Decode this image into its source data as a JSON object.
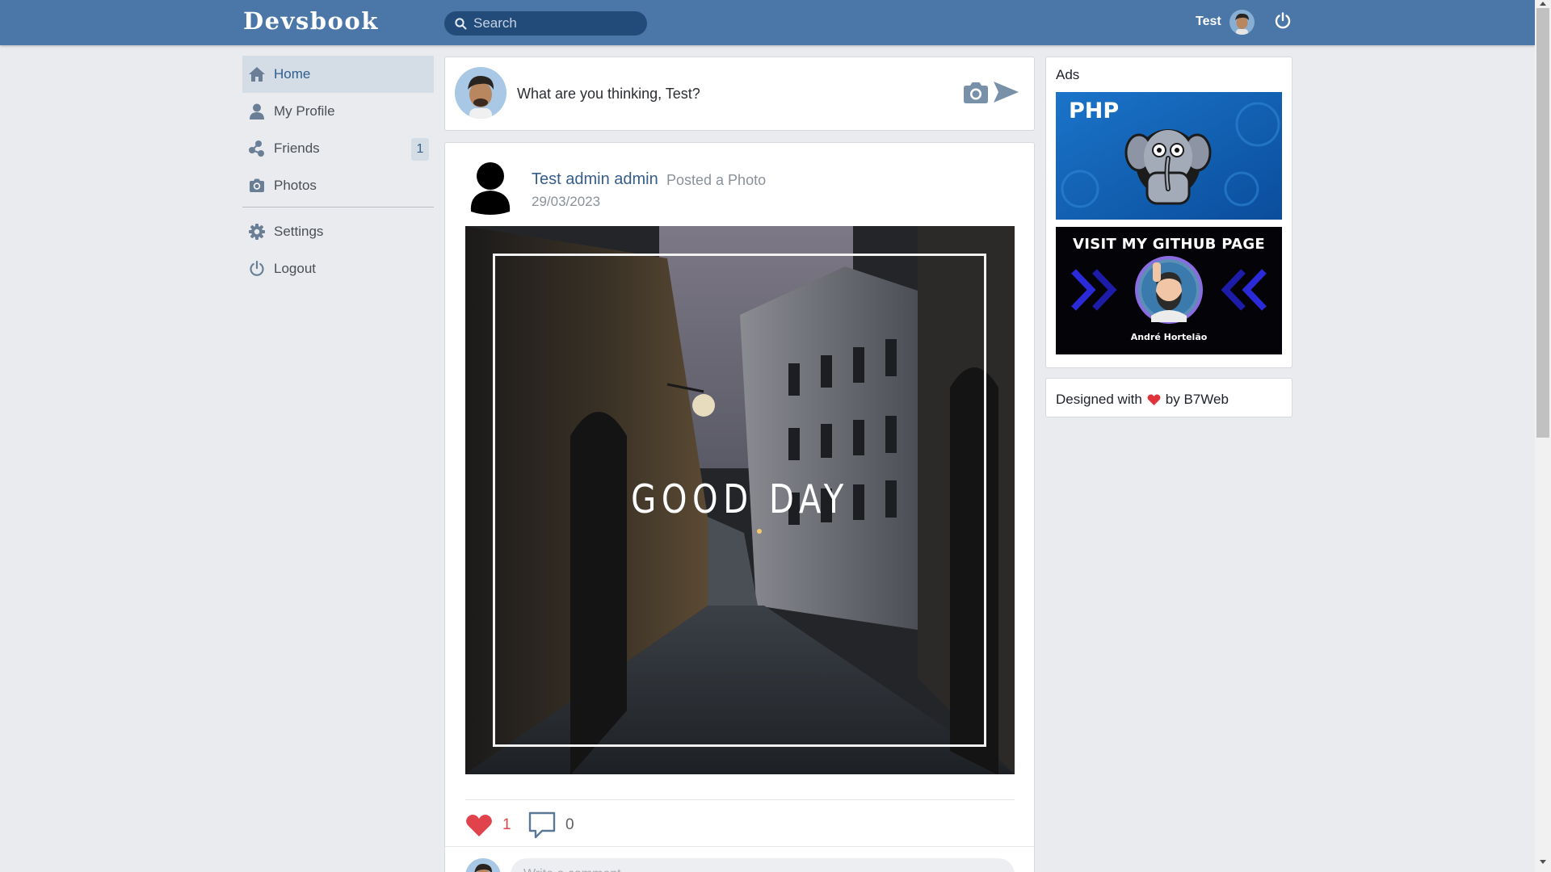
{
  "header": {
    "logo": "Devsbook",
    "search_placeholder": "Search",
    "user_name": "Test"
  },
  "sidebar": {
    "items": [
      {
        "label": "Home",
        "icon": "home-icon",
        "active": true
      },
      {
        "label": "My Profile",
        "icon": "user-icon"
      },
      {
        "label": "Friends",
        "icon": "friends-icon",
        "badge": "1"
      },
      {
        "label": "Photos",
        "icon": "camera-icon"
      },
      {
        "label": "Settings",
        "icon": "gear-icon"
      },
      {
        "label": "Logout",
        "icon": "power-icon"
      }
    ]
  },
  "composer": {
    "prompt": "What are you thinking, Test?"
  },
  "post": {
    "author": "Test admin admin",
    "action": "Posted a Photo",
    "date": "29/03/2023",
    "photo_caption": "GOOD DAY",
    "likes": "1",
    "comments": "0",
    "comment_placeholder": "Write a comment"
  },
  "ads": {
    "title": "Ads",
    "ad1_text": "PHP",
    "ad2_title": "VISIT MY GITHUB PAGE",
    "ad2_name": "André Hortelão"
  },
  "credits": {
    "prefix": "Designed with",
    "suffix": "by B7Web"
  },
  "colors": {
    "header": "#4a76a8",
    "search_bg": "#224b7a",
    "active_nav": "#d4dde6",
    "like": "#e0434b"
  }
}
